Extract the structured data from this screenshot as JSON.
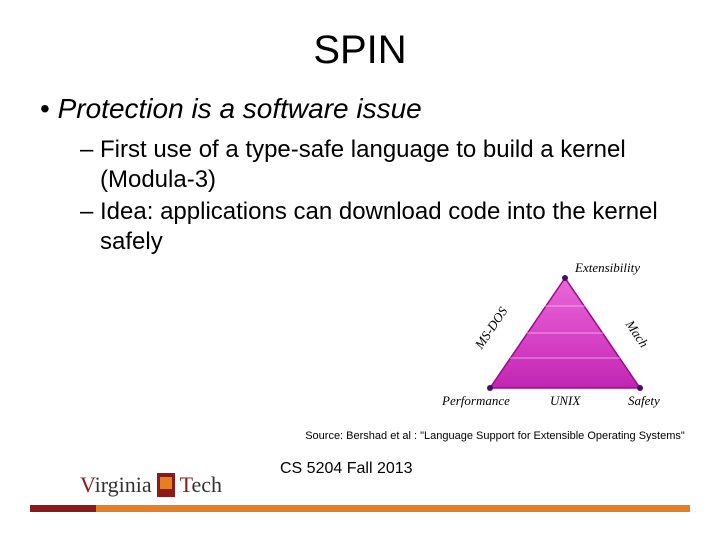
{
  "title": "SPIN",
  "main_bullet": "Protection is a software issue",
  "sub_bullets": [
    "First use of a type-safe language to build a kernel (Modula-3)",
    "Idea: applications can download code into the kernel safely"
  ],
  "triangle": {
    "top": "Extensibility",
    "left_edge": "MS-DOS",
    "right_edge": "Mach",
    "bottom_left": "Performance",
    "bottom_center": "UNIX",
    "bottom_right": "Safety"
  },
  "source": "Source: Bershad et al : \"Language Support for Extensible Operating Systems\"",
  "footer": "CS 5204 Fall 2013",
  "logo": {
    "part1": "Virginia",
    "part2": "Tech"
  }
}
